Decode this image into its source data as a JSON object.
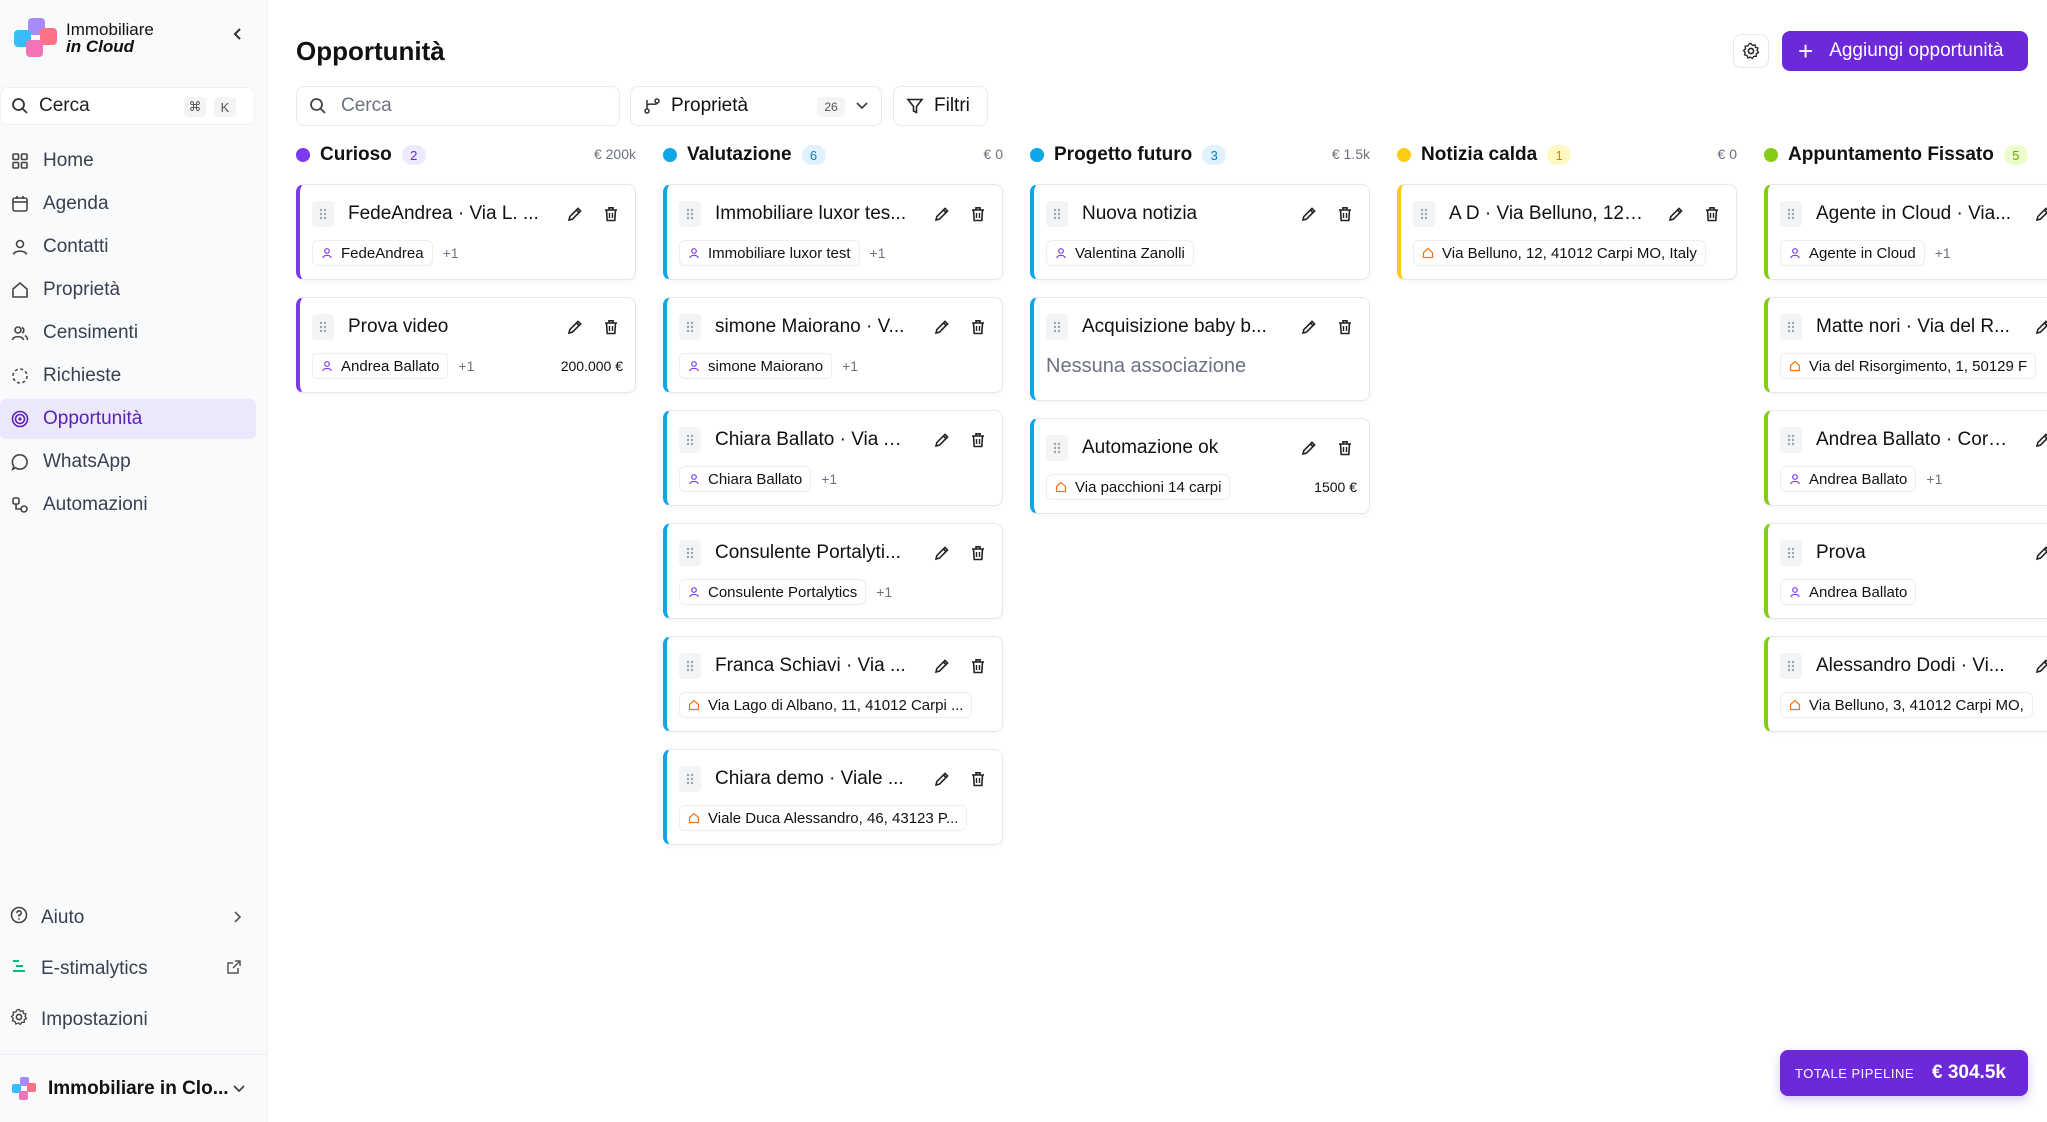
{
  "sidebar": {
    "logo_line1": "Immobiliare",
    "logo_line2": "in Cloud",
    "search_label": "Cerca",
    "search_kbd1": "⌘",
    "search_kbd2": "K",
    "nav": [
      {
        "label": "Home",
        "icon": "grid-icon"
      },
      {
        "label": "Agenda",
        "icon": "calendar-icon"
      },
      {
        "label": "Contatti",
        "icon": "user-icon"
      },
      {
        "label": "Proprietà",
        "icon": "house-icon"
      },
      {
        "label": "Censimenti",
        "icon": "people-icon"
      },
      {
        "label": "Richieste",
        "icon": "dashed-circle-icon"
      },
      {
        "label": "Opportunità",
        "icon": "target-icon"
      },
      {
        "label": "WhatsApp",
        "icon": "whatsapp-icon"
      },
      {
        "label": "Automazioni",
        "icon": "automation-icon"
      }
    ],
    "bottom": [
      {
        "label": "Aiuto",
        "icon": "help-icon"
      },
      {
        "label": "E-stimalytics",
        "icon": "estimalytics-icon"
      },
      {
        "label": "Impostazioni",
        "icon": "gear-icon"
      }
    ],
    "org_name": "Immobiliare in Clo..."
  },
  "header": {
    "title": "Opportunità",
    "add_button": "Aggiungi opportunità",
    "search_placeholder": "Cerca",
    "property_filter": "Proprietà",
    "property_count": "26",
    "filters": "Filtri"
  },
  "columns": [
    {
      "name": "Curioso",
      "count": "2",
      "total": "€ 200k",
      "color": "#7c3aed",
      "cards": [
        {
          "title": "FedeAndrea · Via L. ...",
          "chip": "FedeAndrea",
          "chip_type": "contact",
          "more": "+1",
          "amount": ""
        },
        {
          "title": "Prova video",
          "chip": "Andrea Ballato",
          "chip_type": "contact",
          "more": "+1",
          "amount": "200.000 €"
        }
      ]
    },
    {
      "name": "Valutazione",
      "count": "6",
      "total": "€ 0",
      "color": "#0ea5e9",
      "cards": [
        {
          "title": "Immobiliare luxor tes...",
          "chip": "Immobiliare luxor test",
          "chip_type": "contact",
          "more": "+1",
          "amount": ""
        },
        {
          "title": "simone Maiorano · V...",
          "chip": "simone Maiorano",
          "chip_type": "contact",
          "more": "+1",
          "amount": ""
        },
        {
          "title": "Chiara Ballato · Via A...",
          "chip": "Chiara Ballato",
          "chip_type": "contact",
          "more": "+1",
          "amount": ""
        },
        {
          "title": "Consulente Portalyti...",
          "chip": "Consulente Portalytics",
          "chip_type": "contact",
          "more": "+1",
          "amount": ""
        },
        {
          "title": "Franca Schiavi · Via ...",
          "chip": "Via Lago di Albano, 11, 41012 Carpi ...",
          "chip_type": "property",
          "more": "",
          "amount": ""
        },
        {
          "title": "Chiara demo · Viale ...",
          "chip": "Viale Duca Alessandro, 46, 43123 P...",
          "chip_type": "property",
          "more": "",
          "amount": ""
        }
      ]
    },
    {
      "name": "Progetto futuro",
      "count": "3",
      "total": "€ 1.5k",
      "color": "#0ea5e9",
      "cards": [
        {
          "title": "Nuova notizia",
          "chip": "Valentina Zanolli",
          "chip_type": "contact",
          "more": "",
          "amount": ""
        },
        {
          "title": "Acquisizione baby b...",
          "chip": "",
          "chip_type": "none",
          "empty": "Nessuna associazione",
          "more": "",
          "amount": ""
        },
        {
          "title": "Automazione ok",
          "chip": "Via pacchioni 14 carpi",
          "chip_type": "property",
          "more": "",
          "amount": "1500 €"
        }
      ]
    },
    {
      "name": "Notizia calda",
      "count": "1",
      "total": "€ 0",
      "color": "#facc15",
      "cards": [
        {
          "title": "A D · Via Belluno, 12, ...",
          "chip": "Via Belluno, 12, 41012 Carpi MO, Italy",
          "chip_type": "property",
          "more": "",
          "amount": ""
        }
      ]
    },
    {
      "name": "Appuntamento Fissato",
      "count": "5",
      "total": "",
      "color": "#84cc16",
      "cards": [
        {
          "title": "Agente in Cloud · Via...",
          "chip": "Agente in Cloud",
          "chip_type": "contact",
          "more": "+1",
          "amount": ""
        },
        {
          "title": "Matte nori · Via del R...",
          "chip": "Via del Risorgimento, 1, 50129 F",
          "chip_type": "property",
          "more": "",
          "amount": ""
        },
        {
          "title": "Andrea Ballato · Cors...",
          "chip": "Andrea Ballato",
          "chip_type": "contact",
          "more": "+1",
          "amount": ""
        },
        {
          "title": "Prova",
          "chip": "Andrea Ballato",
          "chip_type": "contact",
          "more": "",
          "amount": ""
        },
        {
          "title": "Alessandro Dodi · Vi...",
          "chip": "Via Belluno, 3, 41012 Carpi MO,",
          "chip_type": "property",
          "more": "",
          "amount": ""
        }
      ]
    }
  ],
  "footer": {
    "total_label": "TOTALE PIPELINE",
    "total_value": "€ 304.5k"
  }
}
